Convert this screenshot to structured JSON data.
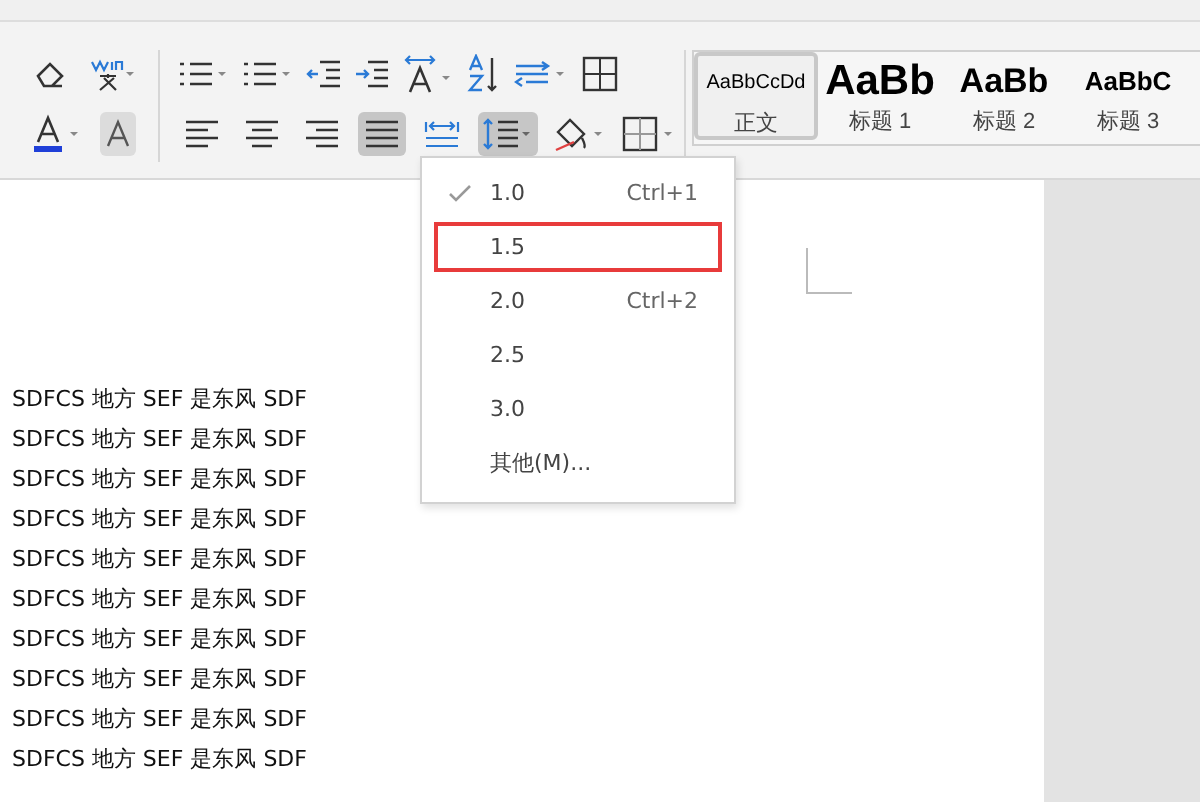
{
  "alignment_buttons": [
    {
      "selected": false
    },
    {
      "selected": false
    },
    {
      "selected": false
    },
    {
      "selected": true
    },
    {
      "selected": false
    }
  ],
  "line_spacing_button": {
    "expanded": true
  },
  "styles": [
    {
      "sample": "AaBbCcDd",
      "label": "正文",
      "kind": "body",
      "selected": true
    },
    {
      "sample": "AaBb",
      "label": "标题 1",
      "kind": "h1",
      "selected": false
    },
    {
      "sample": "AaBb",
      "label": "标题 2",
      "kind": "h2",
      "selected": false
    },
    {
      "sample": "AaBbC",
      "label": "标题 3",
      "kind": "h3",
      "selected": false
    }
  ],
  "line_spacing_menu": [
    {
      "label": "1.0",
      "shortcut": "Ctrl+1",
      "checked": true,
      "highlighted": false
    },
    {
      "label": "1.5",
      "checked": false,
      "highlighted": true
    },
    {
      "label": "2.0",
      "shortcut": "Ctrl+2",
      "checked": false,
      "highlighted": false
    },
    {
      "label": "2.5",
      "checked": false,
      "highlighted": false
    },
    {
      "label": "3.0",
      "checked": false,
      "highlighted": false
    },
    {
      "label": "其他(M)...",
      "checked": false,
      "highlighted": false
    }
  ],
  "document_lines": [
    "SDFCS 地方 SEF 是东风 SDF",
    "SDFCS 地方 SEF 是东风 SDF",
    "SDFCS 地方 SEF 是东风 SDF",
    "SDFCS 地方 SEF 是东风 SDF",
    "SDFCS 地方 SEF 是东风 SDF",
    "SDFCS 地方 SEF 是东风 SDF",
    "SDFCS 地方 SEF 是东风 SDF",
    "SDFCS 地方 SEF 是东风 SDF",
    "SDFCS 地方 SEF 是东风 SDF",
    "SDFCS 地方 SEF 是东风 SDF"
  ]
}
